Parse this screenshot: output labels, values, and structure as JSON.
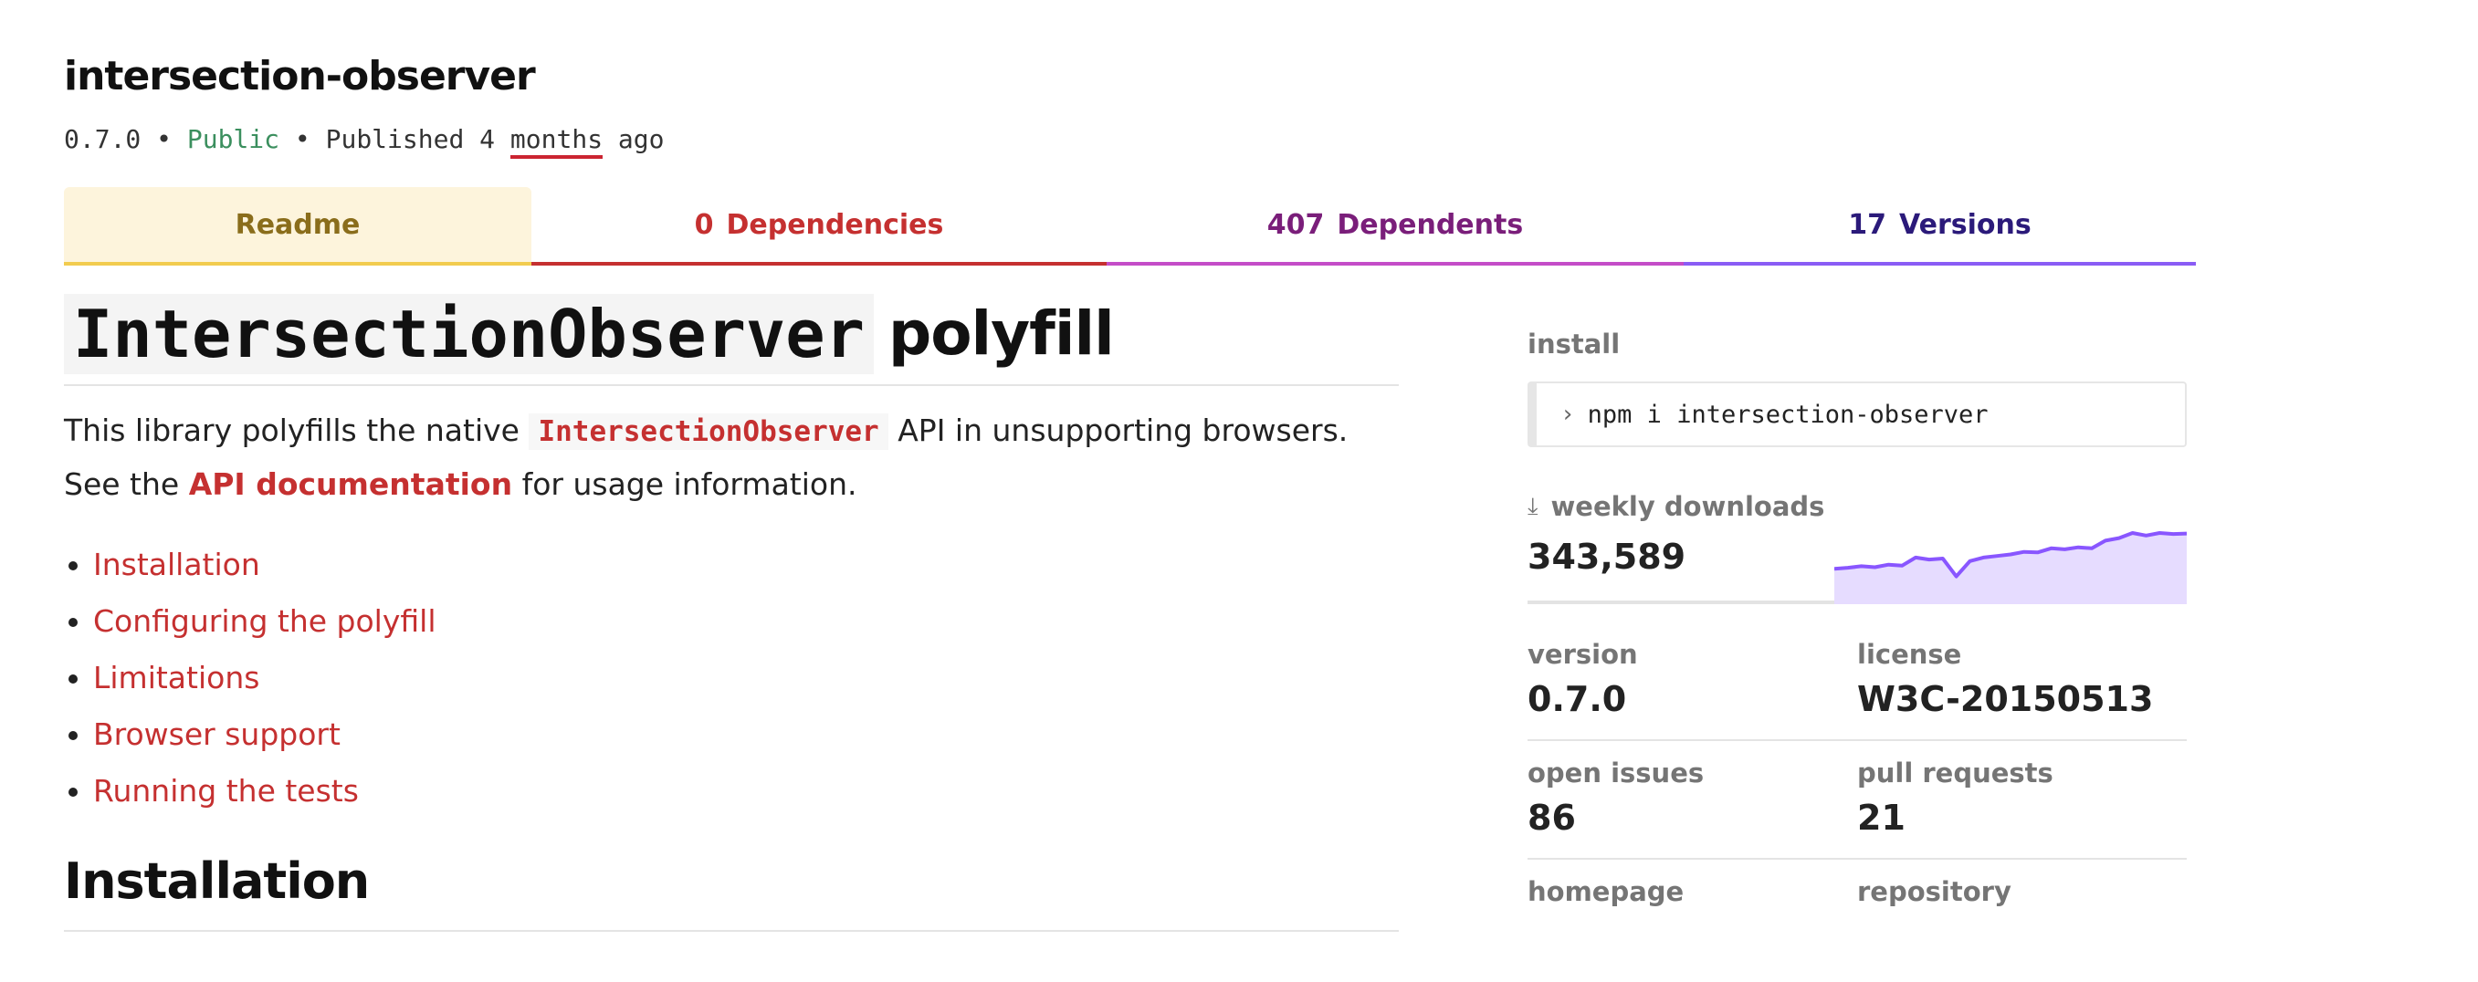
{
  "package": {
    "name": "intersection-observer",
    "version": "0.7.0",
    "visibility": "Public",
    "published_prefix": "Published 4",
    "published_unit": "months",
    "published_suffix": "ago",
    "separator": "•"
  },
  "tabs": [
    {
      "label": "Readme"
    },
    {
      "count": "0",
      "label": "Dependencies"
    },
    {
      "count": "407",
      "label": "Dependents"
    },
    {
      "count": "17",
      "label": "Versions"
    }
  ],
  "readme": {
    "title_code": "IntersectionObserver",
    "title_text": "polyfill",
    "intro_before": "This library polyfills the native",
    "intro_code": "IntersectionObserver",
    "intro_middle": "API in unsupporting browsers. See the",
    "intro_link": "API documentation",
    "intro_after": "for usage information.",
    "toc": [
      "Installation",
      "Configuring the polyfill",
      "Limitations",
      "Browser support",
      "Running the tests"
    ],
    "section_heading": "Installation"
  },
  "sidebar": {
    "install_label": "install",
    "install_prompt": "›",
    "install_command": "npm i intersection-observer",
    "downloads_label": "weekly downloads",
    "downloads_count": "343,589",
    "downloads_trend": [
      0.3,
      0.32,
      0.35,
      0.33,
      0.38,
      0.36,
      0.52,
      0.48,
      0.5,
      0.15,
      0.45,
      0.52,
      0.55,
      0.58,
      0.63,
      0.62,
      0.7,
      0.68,
      0.72,
      0.7,
      0.85,
      0.9,
      1.0,
      0.95,
      1.0,
      0.98,
      0.99
    ],
    "accent_color": "#8956ff",
    "stats": [
      [
        {
          "label": "version",
          "value": "0.7.0"
        },
        {
          "label": "license",
          "value": "W3C-20150513"
        }
      ],
      [
        {
          "label": "open issues",
          "value": "86"
        },
        {
          "label": "pull requests",
          "value": "21"
        }
      ],
      [
        {
          "label": "homepage",
          "value": ""
        },
        {
          "label": "repository",
          "value": ""
        }
      ]
    ]
  }
}
